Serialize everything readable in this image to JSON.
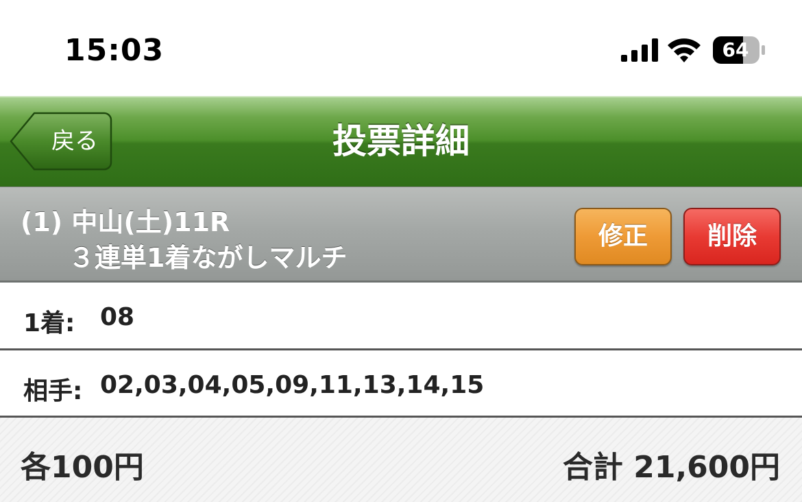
{
  "status_bar": {
    "time": "15:03",
    "battery": "64",
    "icons": [
      "signal-icon",
      "wifi-icon",
      "battery-icon"
    ]
  },
  "nav": {
    "back_label": "戻る",
    "title": "投票詳細"
  },
  "race": {
    "line1": "(1) 中山(土)11R",
    "line2": "３連単1着ながしマルチ",
    "edit_label": "修正",
    "delete_label": "削除"
  },
  "rows": [
    {
      "label": "1着:",
      "value": "08"
    },
    {
      "label": "相手:",
      "value": "02,03,04,05,09,11,13,14,15"
    }
  ],
  "footer": {
    "unit_price": "各100円",
    "total": "合計 21,600円"
  },
  "colors": {
    "nav_green": "#3a7a1e",
    "edit_orange": "#ee9a36",
    "delete_red": "#e83a33",
    "header_gray": "#a4a8a6"
  }
}
